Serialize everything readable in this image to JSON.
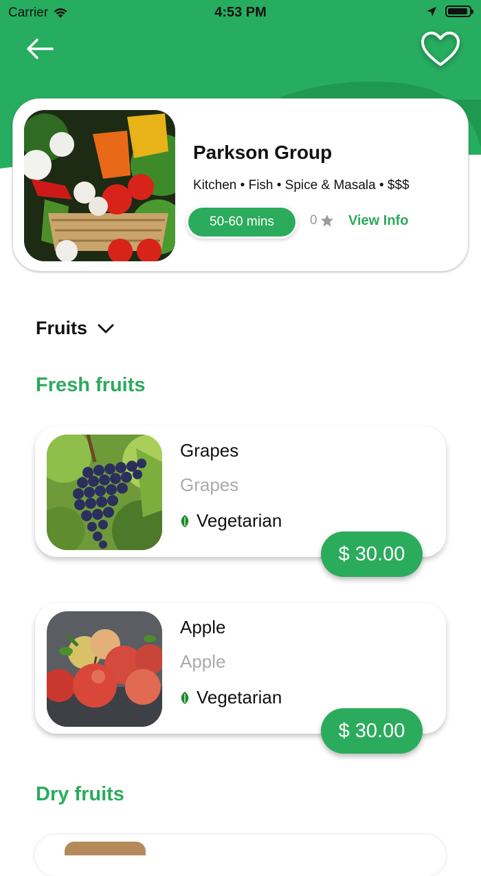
{
  "status_bar": {
    "carrier": "Carrier",
    "time": "4:53 PM"
  },
  "colors": {
    "brand_green": "#2bab5c",
    "header_green": "#27ad60",
    "muted_gray": "#aaaaaa"
  },
  "header": {
    "back_icon": "arrow-left-icon",
    "favorite_icon": "heart-outline-icon"
  },
  "store": {
    "name": "Parkson Group",
    "tags": "Kitchen • Fish • Spice & Masala • $$$",
    "delivery_time": "50-60 mins",
    "rating": "0",
    "view_info": "View Info"
  },
  "category_selector": {
    "label": "Fruits"
  },
  "sections": [
    {
      "title": "Fresh fruits",
      "items": [
        {
          "name": "Grapes",
          "subtitle": "Grapes",
          "diet": "Vegetarian",
          "price": "$ 30.00"
        },
        {
          "name": "Apple",
          "subtitle": "Apple",
          "diet": "Vegetarian",
          "price": "$ 30.00"
        }
      ]
    },
    {
      "title": "Dry fruits",
      "items": []
    }
  ]
}
